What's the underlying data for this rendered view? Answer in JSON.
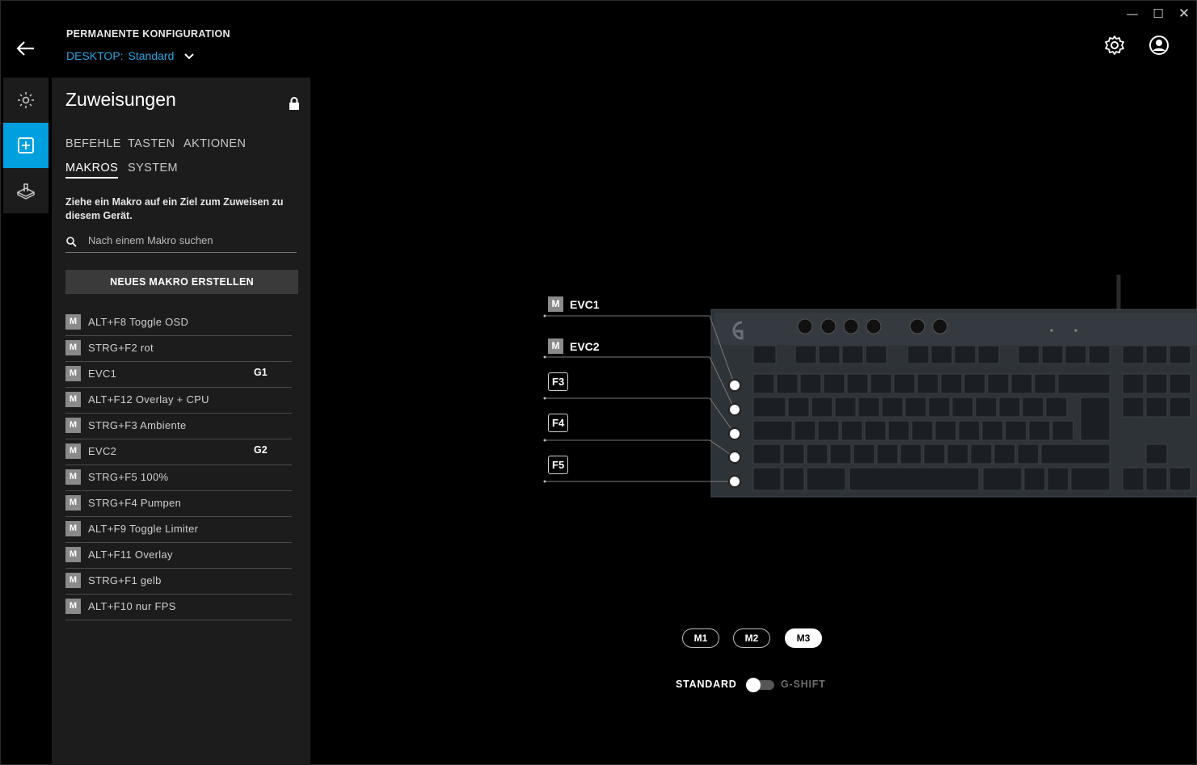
{
  "window": {
    "minimize_icon": "minimize-icon",
    "maximize_icon": "maximize-icon",
    "close_icon": "close-icon"
  },
  "header": {
    "config_title": "PERMANENTE KONFIGURATION",
    "profile_prefix": "DESKTOP:",
    "profile_name": "Standard"
  },
  "rail": {
    "items": [
      "lighting-icon",
      "assignments-icon",
      "game-mode-icon"
    ],
    "active_color": "#00a0df"
  },
  "panel": {
    "title": "Zuweisungen",
    "tabs": [
      "BEFEHLE",
      "TASTEN",
      "AKTIONEN",
      "MAKROS",
      "SYSTEM"
    ],
    "active_tab": "MAKROS",
    "hint": "Ziehe ein Makro auf ein Ziel zum Zuweisen zu diesem Gerät.",
    "search_placeholder": "Nach einem Makro suchen",
    "new_macro_label": "NEUES MAKRO ERSTELLEN",
    "macros": [
      {
        "badge": "M",
        "label": "ALT+F8 Toggle OSD",
        "key": ""
      },
      {
        "badge": "M",
        "label": "STRG+F2 rot",
        "key": ""
      },
      {
        "badge": "M",
        "label": "EVC1",
        "key": "G1"
      },
      {
        "badge": "M",
        "label": "ALT+F12 Overlay + CPU",
        "key": ""
      },
      {
        "badge": "M",
        "label": "STRG+F3 Ambiente",
        "key": ""
      },
      {
        "badge": "M",
        "label": "EVC2",
        "key": "G2"
      },
      {
        "badge": "M",
        "label": "STRG+F5 100%",
        "key": ""
      },
      {
        "badge": "M",
        "label": "STRG+F4 Pumpen",
        "key": ""
      },
      {
        "badge": "M",
        "label": "ALT+F9 Toggle Limiter",
        "key": ""
      },
      {
        "badge": "M",
        "label": "ALT+F11 Overlay",
        "key": ""
      },
      {
        "badge": "M",
        "label": "STRG+F1 gelb",
        "key": ""
      },
      {
        "badge": "M",
        "label": "ALT+F10 nur FPS",
        "key": ""
      }
    ]
  },
  "device": {
    "assignments": [
      {
        "badge": "M",
        "label": "EVC1"
      },
      {
        "badge": "M",
        "label": "EVC2"
      },
      {
        "badge": "",
        "label": "F3"
      },
      {
        "badge": "",
        "label": "F4"
      },
      {
        "badge": "",
        "label": "F5"
      }
    ],
    "modes": [
      "M1",
      "M2",
      "M3"
    ],
    "active_mode": "M3",
    "toggle_left": "STANDARD",
    "toggle_right": "G-SHIFT",
    "gshift_enabled": false
  }
}
